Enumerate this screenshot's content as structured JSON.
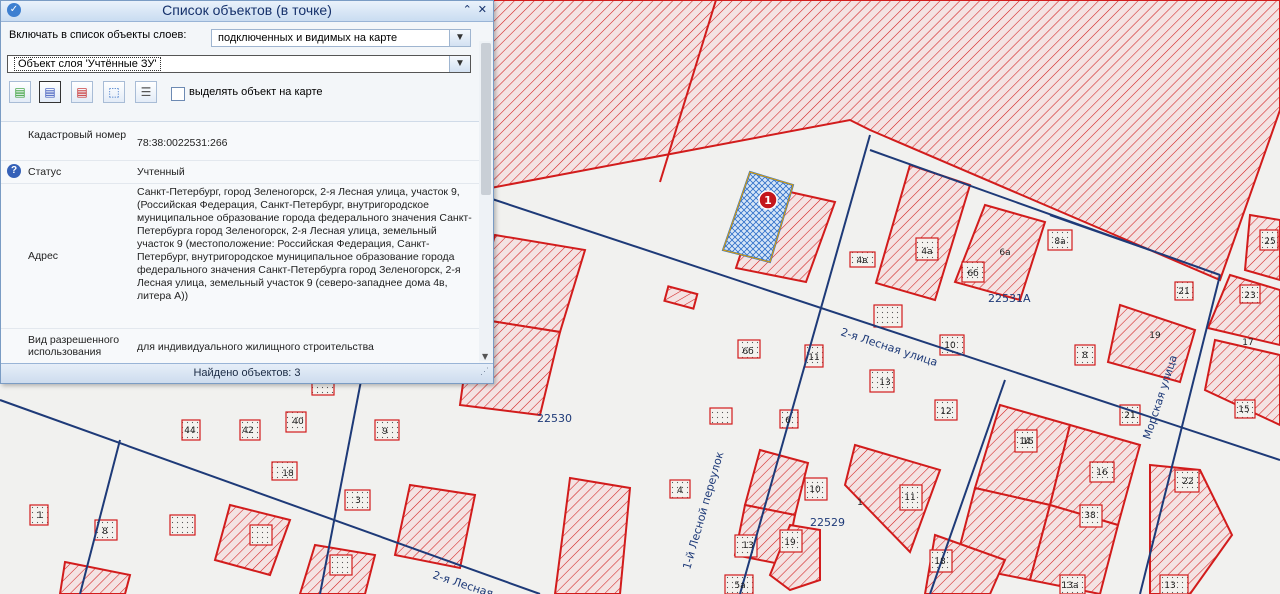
{
  "panel": {
    "title": "Список объектов (в точке)",
    "include_label": "Включать в список объекты слоев:",
    "include_value": "подключенных и видимых на карте",
    "object_value": "Объект слоя 'Учтённые ЗУ'",
    "highlight_label": "выделять объект на карте",
    "rows": [
      {
        "key": "Кадастровый номер",
        "value": "78:38:0022531:266"
      },
      {
        "key": "Статус",
        "value": "Учтенный"
      },
      {
        "key": "Адрес",
        "value": "Санкт-Петербург, город Зеленогорск, 2-я Лесная улица, участок 9, (Российская Федерация, Санкт-Петербург, внутригородское муниципальное образование города федерального значения Санкт-Петербурга город Зеленогорск, 2-я Лесная улица, земельный участок 9 (местоположение: Российская Федерация, Санкт-Петербург, внутригородское муниципальное образование города федерального значения Санкт-Петербурга город Зеленогорск, 2-я Лесная улица, земельный участок 9 (северо-западнее дома 4в, литера А))"
      },
      {
        "key": "Вид разрешенного использования",
        "value": "для индивидуального жилищного строительства"
      }
    ],
    "status_text": "Найдено объектов: 3"
  },
  "map": {
    "quarter_labels": [
      "22531А",
      "22530",
      "22529"
    ],
    "street_2_lesnaya": "2-я Лесная улица",
    "street_2_lesnaya_short": "2-я Лесная",
    "street_1_lesnoy": "1-й Лесной переулок",
    "street_morskaya": "Морская улица",
    "marker_label": "1",
    "lot_labels": [
      "4в",
      "4а",
      "6б",
      "6а",
      "8а",
      "25",
      "23",
      "21",
      "19",
      "17",
      "15",
      "6б",
      "8",
      "10",
      "11",
      "13",
      "12",
      "14",
      "16",
      "18",
      "21",
      "22",
      "38",
      "40",
      "42",
      "44",
      "1",
      "4",
      "6",
      "8",
      "9",
      "10",
      "11",
      "13а",
      "13",
      "15",
      "18",
      "19",
      "13",
      "5а",
      "3",
      "1"
    ]
  },
  "colors": {
    "parcel_red": "#d21c1c",
    "street_blue": "#1e3a78",
    "selected_blue": "#3f7fd6"
  }
}
